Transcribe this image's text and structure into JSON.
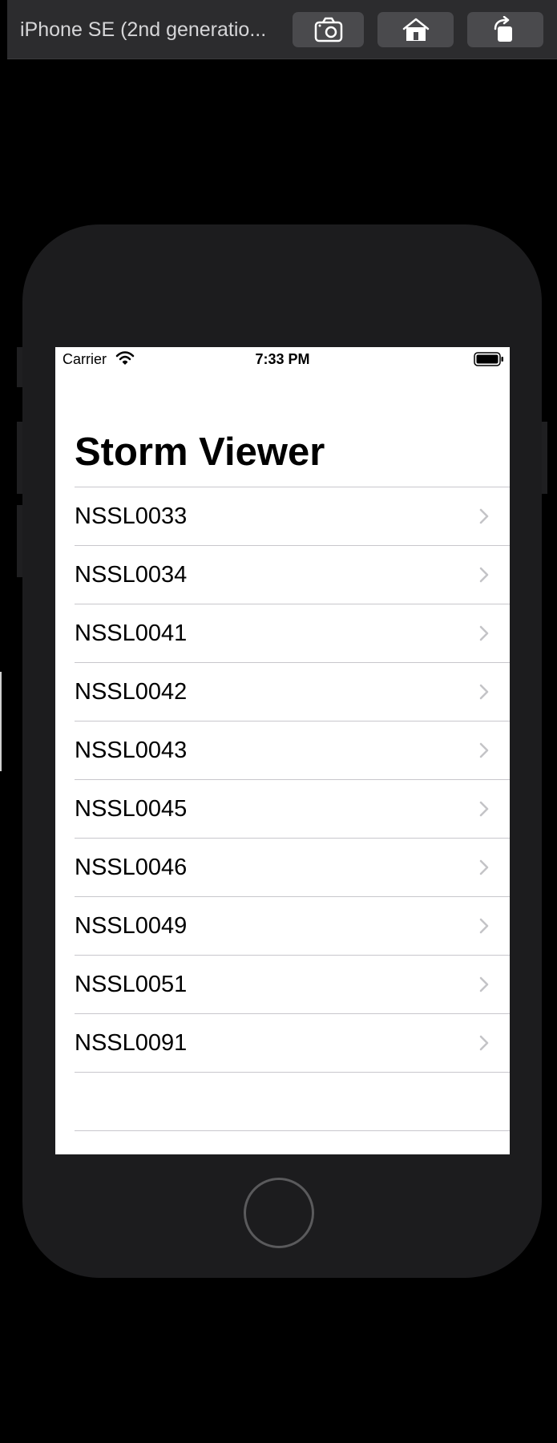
{
  "toolbar": {
    "device_name": "iPhone SE (2nd generatio...",
    "buttons": [
      {
        "name": "screenshot",
        "icon": "camera-icon"
      },
      {
        "name": "home",
        "icon": "home-icon"
      },
      {
        "name": "rotate",
        "icon": "rotate-icon"
      }
    ]
  },
  "status_bar": {
    "carrier": "Carrier",
    "time": "7:33 PM"
  },
  "nav": {
    "title": "Storm Viewer"
  },
  "pictures": [
    "NSSL0033",
    "NSSL0034",
    "NSSL0041",
    "NSSL0042",
    "NSSL0043",
    "NSSL0045",
    "NSSL0046",
    "NSSL0049",
    "NSSL0051",
    "NSSL0091"
  ],
  "colors": {
    "background": "#000000",
    "toolbar": "#2c2c2e",
    "device_body": "#1c1c1e",
    "screen": "#ffffff",
    "separator": "#c8c7cc",
    "chevron": "#c4c4c7"
  }
}
